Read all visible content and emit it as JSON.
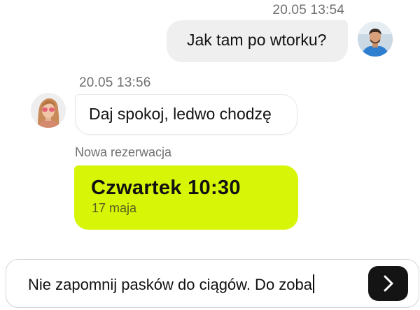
{
  "messages": [
    {
      "direction": "outgoing",
      "timestamp": "20.05 13:54",
      "text": "Jak tam po wtorku?"
    },
    {
      "direction": "incoming",
      "timestamp": "20.05 13:56",
      "text": "Daj spokoj, ledwo chodzę"
    }
  ],
  "reservation": {
    "label": "Nowa rezerwacja",
    "day_time": "Czwartek 10:30",
    "date": "17 maja",
    "accent_color": "#d7f507"
  },
  "composer": {
    "value": "Nie zapomnij pasków do ciągów. Do zoba",
    "send_icon": "chevron-right-icon"
  },
  "colors": {
    "outgoing_bubble": "#efefef",
    "incoming_bubble": "#ffffff",
    "send_button": "#141414",
    "timestamp_text": "#6f6f6f"
  }
}
